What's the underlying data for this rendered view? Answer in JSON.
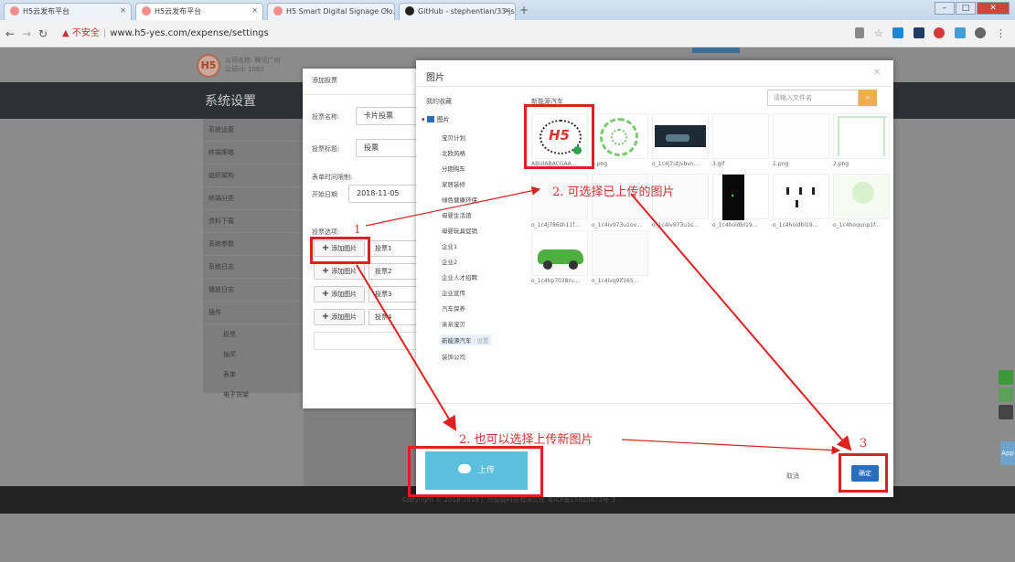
{
  "browser": {
    "tabs": [
      {
        "label": "H5云发布平台"
      },
      {
        "label": "H5云发布平台"
      },
      {
        "label": "H5 Smart Digital Signage Clo..."
      },
      {
        "label": "GitHub - stephentian/33-js-co..."
      }
    ],
    "security_label": "不安全",
    "url": "www.h5-yes.com/expense/settings"
  },
  "header": {
    "logo_text": "H5",
    "company_name": "公司名称: 腾讯广州",
    "company_id": "公司id: 1083",
    "page_title": "系统设置"
  },
  "sidebar": {
    "items": [
      {
        "label": "系统设置"
      },
      {
        "label": "终端策略"
      },
      {
        "label": "组织架构"
      },
      {
        "label": "终端分类"
      },
      {
        "label": "资料下载"
      },
      {
        "label": "系统参数"
      },
      {
        "label": "系统日志"
      },
      {
        "label": "播放日志"
      },
      {
        "label": "插件"
      }
    ],
    "plugins": [
      {
        "label": "投票"
      },
      {
        "label": "抽奖"
      },
      {
        "label": "表单"
      },
      {
        "label": "电子货架"
      }
    ]
  },
  "vote_modal": {
    "title": "添加投票",
    "name_label": "投票名称:",
    "name_value": "卡片投票",
    "subject_label": "投票标题:",
    "subject_value": "投票",
    "time_limit_label": "表单时间限制:",
    "start_label": "开始日期",
    "start_value": "2018-11-05",
    "options_label": "投票选项:",
    "add_image_label": "添加图片",
    "options": [
      {
        "value": "投票1"
      },
      {
        "value": "投票2"
      },
      {
        "value": "投票3"
      },
      {
        "value": "投票4"
      }
    ]
  },
  "picker": {
    "title": "图片",
    "favorites_label": "我的收藏",
    "current_folder": "新能源汽车",
    "search_placeholder": "请输入文件名",
    "root_folder": "图片",
    "setting_label": "设置",
    "folders": [
      {
        "label": "宝贝计划"
      },
      {
        "label": "北欧风格"
      },
      {
        "label": "分期购车"
      },
      {
        "label": "家居装修"
      },
      {
        "label": "绿色健康环保"
      },
      {
        "label": "母婴生活馆"
      },
      {
        "label": "母婴玩具促销"
      },
      {
        "label": "企业1"
      },
      {
        "label": "企业2"
      },
      {
        "label": "企业人才招聘"
      },
      {
        "label": "企业宣传"
      },
      {
        "label": "汽车保养"
      },
      {
        "label": "亲亲宝贝"
      },
      {
        "label": "新能源汽车"
      },
      {
        "label": "装饰公司"
      }
    ],
    "images": [
      {
        "name": "ABUIABACGAA..."
      },
      {
        "name": "5.png"
      },
      {
        "name": "o_1c4j7utjvbvn..."
      },
      {
        "name": "3.gif"
      },
      {
        "name": "1.png"
      },
      {
        "name": "2.png"
      },
      {
        "name": "o_1c4j786sh11f..."
      },
      {
        "name": "o_1c4iv973u1ov..."
      },
      {
        "name": "o_1c4iv973u1s..."
      },
      {
        "name": "o_1c4holdbl19..."
      },
      {
        "name": "o_1c4holdbl19..."
      },
      {
        "name": "o_1c4hoqunp1f..."
      },
      {
        "name": "o_1c4hp7038ru..."
      },
      {
        "name": "o_1c4ivq9if165..."
      }
    ],
    "upload_label": "上传",
    "cancel_label": "取消",
    "confirm_label": "确定"
  },
  "footer": {
    "text": "Copyright © 2018-2019 广州智能科技有限公司 粤ICP备15025672号-3"
  },
  "annotations": {
    "step1": "1",
    "step2a": "2. 可选择已上传的图片",
    "step2b": "2. 也可以选择上传新图片",
    "step3": "3"
  },
  "colors": {
    "annotation": "#e02020",
    "upload_button": "#5bc0de",
    "confirm_button": "#2a6ebb",
    "search_button": "#f0ad4e"
  }
}
